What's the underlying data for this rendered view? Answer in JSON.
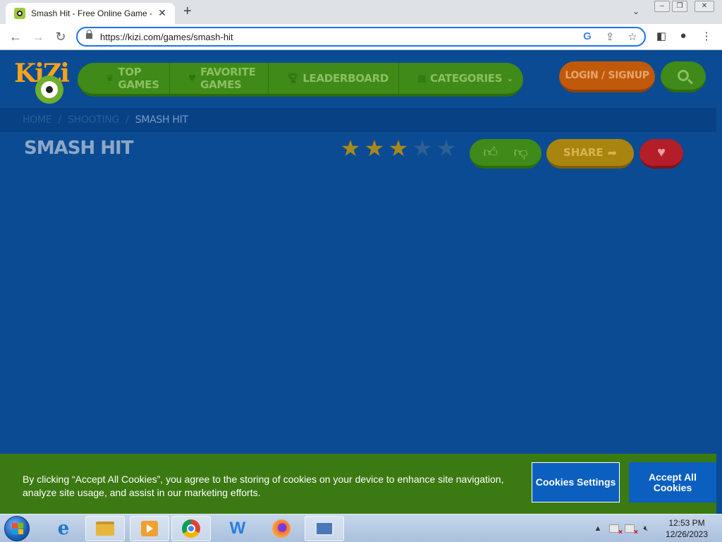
{
  "browser": {
    "tab_title": "Smash Hit - Free Online Game - K",
    "tab_close_icon": "close-icon",
    "new_tab_label": "+",
    "url": "https://kizi.com/games/smash-hit",
    "url_before_caret": "https://kizi.com/games/smash-hit"
  },
  "site": {
    "logo_text": "KiZi",
    "nav": [
      {
        "label": "TOP GAMES",
        "icon": "crown-icon"
      },
      {
        "label": "FAVORITE GAMES",
        "icon": "heart-icon"
      },
      {
        "label": "LEADERBOARD",
        "icon": "trophy-icon"
      },
      {
        "label": "CATEGORIES",
        "icon": "grid-icon"
      }
    ],
    "login_label": "LOGIN / SIGNUP",
    "breadcrumb": [
      "HOME",
      "SHOOTING",
      "SMASH HIT"
    ],
    "breadcrumb_sep": "/",
    "game_title": "SMASH HIT",
    "rating": {
      "value": 3,
      "max": 5
    },
    "share_label": "SHARE"
  },
  "cookie_banner": {
    "text": "By clicking “Accept All Cookies”, you agree to the storing of cookies on your device to enhance site navigation, analyze site usage, and assist in our marketing efforts.",
    "settings_label": "Cookies Settings",
    "accept_label": "Accept All Cookies"
  },
  "taskbar": {
    "time": "12:53 PM",
    "date": "12/26/2023"
  },
  "colors": {
    "page_bg": "#0b4b93",
    "nav_green": "#3f8a18",
    "login_orange": "#c05a0a",
    "share_gold": "#a9850f",
    "fav_red": "#b31e28",
    "cookie_green": "#3b7a12",
    "cookie_button_blue": "#0b5fbf"
  }
}
